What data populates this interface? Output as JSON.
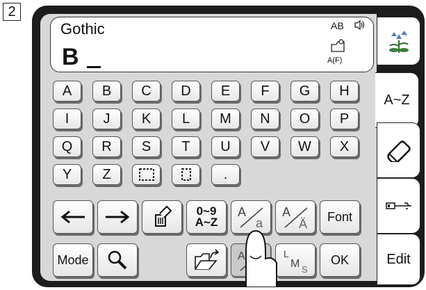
{
  "step": {
    "number": "2"
  },
  "display": {
    "font_name": "Gothic",
    "input_text": "B",
    "case_indicator": "AB",
    "pocket_label": "A(F)"
  },
  "keyboard": {
    "row1": [
      "A",
      "B",
      "C",
      "D",
      "E",
      "F",
      "G",
      "H"
    ],
    "row2": [
      "I",
      "J",
      "K",
      "L",
      "M",
      "N",
      "O",
      "P"
    ],
    "row3": [
      "Q",
      "R",
      "S",
      "T",
      "U",
      "V",
      "W",
      "X"
    ],
    "row4": [
      "Y",
      "Z",
      "",
      "",
      "."
    ]
  },
  "function_keys": {
    "numbers_line1": "0~9",
    "numbers_line2": "A~Z",
    "font": "Font",
    "mode": "Mode",
    "ok": "OK"
  },
  "tabs": {
    "alphabet": "A~Z",
    "edit": "Edit"
  },
  "icons": [
    "speaker-icon",
    "pocket-icon",
    "flower-icon",
    "eraser-icon",
    "usb-icon",
    "left-arrow-icon",
    "right-arrow-icon",
    "delete-icon",
    "search-icon",
    "open-folder-icon",
    "hand-pointer-icon"
  ]
}
